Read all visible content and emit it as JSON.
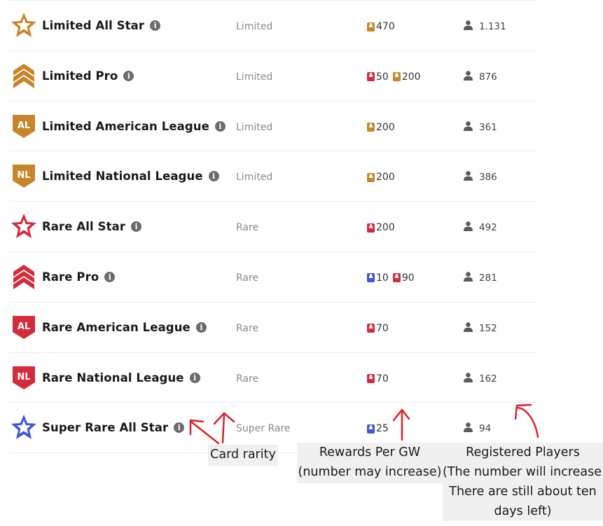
{
  "colors": {
    "limited": "#c8862b",
    "rare": "#d42c3b",
    "super_rare": "#4257d6",
    "annotation": "#e0202a"
  },
  "rows": [
    {
      "name": "Limited All Star",
      "rarity": "Limited",
      "badge": "star",
      "tier": "limited",
      "rewards": [
        {
          "tier": "limited",
          "value": "470"
        }
      ],
      "players": "1.131"
    },
    {
      "name": "Limited Pro",
      "rarity": "Limited",
      "badge": "chevron",
      "tier": "limited",
      "rewards": [
        {
          "tier": "rare",
          "value": "50"
        },
        {
          "tier": "limited",
          "value": "200"
        }
      ],
      "players": "876"
    },
    {
      "name": "Limited American League",
      "rarity": "Limited",
      "badge": "AL",
      "tier": "limited",
      "rewards": [
        {
          "tier": "limited",
          "value": "200"
        }
      ],
      "players": "361"
    },
    {
      "name": "Limited National League",
      "rarity": "Limited",
      "badge": "NL",
      "tier": "limited",
      "rewards": [
        {
          "tier": "limited",
          "value": "200"
        }
      ],
      "players": "386"
    },
    {
      "name": "Rare All Star",
      "rarity": "Rare",
      "badge": "star",
      "tier": "rare",
      "rewards": [
        {
          "tier": "rare",
          "value": "200"
        }
      ],
      "players": "492"
    },
    {
      "name": "Rare Pro",
      "rarity": "Rare",
      "badge": "chevron",
      "tier": "rare",
      "rewards": [
        {
          "tier": "super_rare",
          "value": "10"
        },
        {
          "tier": "rare",
          "value": "90"
        }
      ],
      "players": "281"
    },
    {
      "name": "Rare American League",
      "rarity": "Rare",
      "badge": "AL",
      "tier": "rare",
      "rewards": [
        {
          "tier": "rare",
          "value": "70"
        }
      ],
      "players": "152"
    },
    {
      "name": "Rare National League",
      "rarity": "Rare",
      "badge": "NL",
      "tier": "rare",
      "rewards": [
        {
          "tier": "rare",
          "value": "70"
        }
      ],
      "players": "162"
    },
    {
      "name": "Super Rare All Star",
      "rarity": "Super Rare",
      "badge": "star",
      "tier": "super_rare",
      "rewards": [
        {
          "tier": "super_rare",
          "value": "25"
        }
      ],
      "players": "94"
    }
  ],
  "annotations": {
    "card_rarity": "Card rarity",
    "rewards_line1": "Rewards Per GW",
    "rewards_line2": "(number may increase)",
    "players_line1": "Registered Players",
    "players_line2": "(The number will increase!",
    "players_line3": "There are still about ten",
    "players_line4": "days left)"
  }
}
